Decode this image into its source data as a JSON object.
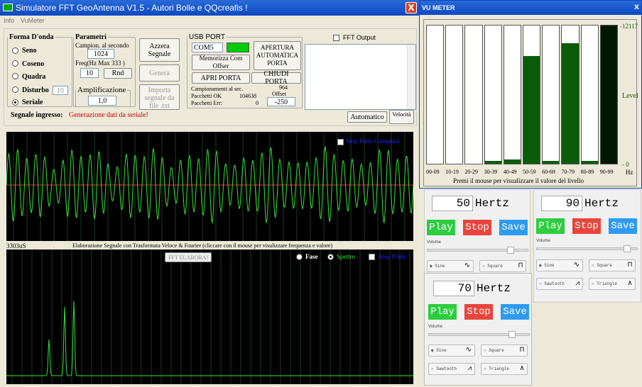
{
  "app": {
    "title": "Simulatore FFT GeoAntenna V1.5 - Autori Bolle e QQcreafis !",
    "close": "X",
    "menu": [
      "Info",
      "VuMeter"
    ]
  },
  "waveform": {
    "legend": "Forma D'onda",
    "options": [
      "Seno",
      "Coseno",
      "Quadra",
      "Disturbo",
      "Seriale"
    ],
    "selected": "Seriale",
    "disturbo_value": "10"
  },
  "params": {
    "legend": "Parametri",
    "rate_label": "Campion. al secondo",
    "rate_value": "1024",
    "freq_label": "Freq(Hz  Max 333  )",
    "freq_value": "10",
    "rnd": "Rnd",
    "amp_label": "Amplificazione",
    "amp_value": "1,0"
  },
  "buttons": {
    "azzera": "Azzera Segnale",
    "genera": "Genera",
    "importa": "Importa segnale da file .txt",
    "automatico": "Automatico",
    "velocita": "Velocità"
  },
  "usb": {
    "legend": "USB PORT",
    "port": "COM5",
    "memorizza": "Memorizza Com Offser",
    "apertura": "APERTURA AUTOMATICA PORTA",
    "apri": "APRI PORTA",
    "chiudi": "CHIUDI PORTA",
    "campionamenti_label": "Campionamenti al sec.",
    "campionamenti_value": "964",
    "pacchetti_ok_label": "Pacchetti OK",
    "pacchetti_ok_value": "104638",
    "pacchetti_err_label": "Pacchetti Err:",
    "pacchetti_err_value": "0",
    "offset_label": "Offset",
    "offset_value": "-250",
    "status_color": "#00cc00"
  },
  "fft_output": {
    "label": "FFT Output",
    "checked": false
  },
  "signal": {
    "label": "Segnale ingresso:",
    "status": "Generazione dati da seriale!"
  },
  "scope1": {
    "checkbox_label": "Stop Punti Campioni",
    "time": "3303uS",
    "caption": "Elaborazione Segnale con Trasformata Veloce & Fourier (cliccare con il mouse per visulizzare frequenza e valore)"
  },
  "scope2": {
    "fft_button": "FFT ELABORA!",
    "fase": "Fase",
    "spettro": "Spettro",
    "stop": "Stop Punti",
    "selected": "Spettro"
  },
  "vumeter": {
    "title": "VU METER",
    "close": "X",
    "top_value": "-12117",
    "level_label": "Level",
    "bottom_value": "- 0",
    "unit": "Hz",
    "hint": "Premi il mouse per visualizzare il valore del livello",
    "bands": [
      "00-09",
      "10-19",
      "20-29",
      "30-39",
      "40-49",
      "50-59",
      "60-69",
      "70-79",
      "80-89",
      "90-99"
    ],
    "levels": [
      0,
      0,
      0,
      0.02,
      0.03,
      0.78,
      0.02,
      0.87,
      0.02,
      1.0
    ],
    "bar_color": "#0a5c0a",
    "peak_color": "#001800"
  },
  "generators": [
    {
      "freq": "50",
      "unit": "Hertz",
      "play": "Play",
      "stop": "Stop",
      "save": "Save",
      "volume_label": "Volume",
      "volume": 0.8,
      "waves": [
        "Sine",
        "Square"
      ],
      "selected": "Sine"
    },
    {
      "freq": "90",
      "unit": "Hertz",
      "play": "Play",
      "stop": "Stop",
      "save": "Save",
      "volume_label": "Volume",
      "volume": 0.88,
      "waves": [
        "Sine",
        "Square",
        "Sawtooth",
        "Triangle"
      ],
      "selected": "Sine"
    },
    {
      "freq": "70",
      "unit": "Hertz",
      "play": "Play",
      "stop": "Stop",
      "save": "Save",
      "volume_label": "Volume",
      "volume": 0.8,
      "waves": [
        "Sine",
        "Square",
        "Sawtooth",
        "Triangle"
      ],
      "selected": "Sine"
    }
  ],
  "colors": {
    "play": "#2ecc40",
    "stop": "#e8453c",
    "save": "#2f9bf0",
    "signal_trace": "#3ae03a",
    "midline": "#e03030",
    "grid": "#1d3a1d"
  }
}
